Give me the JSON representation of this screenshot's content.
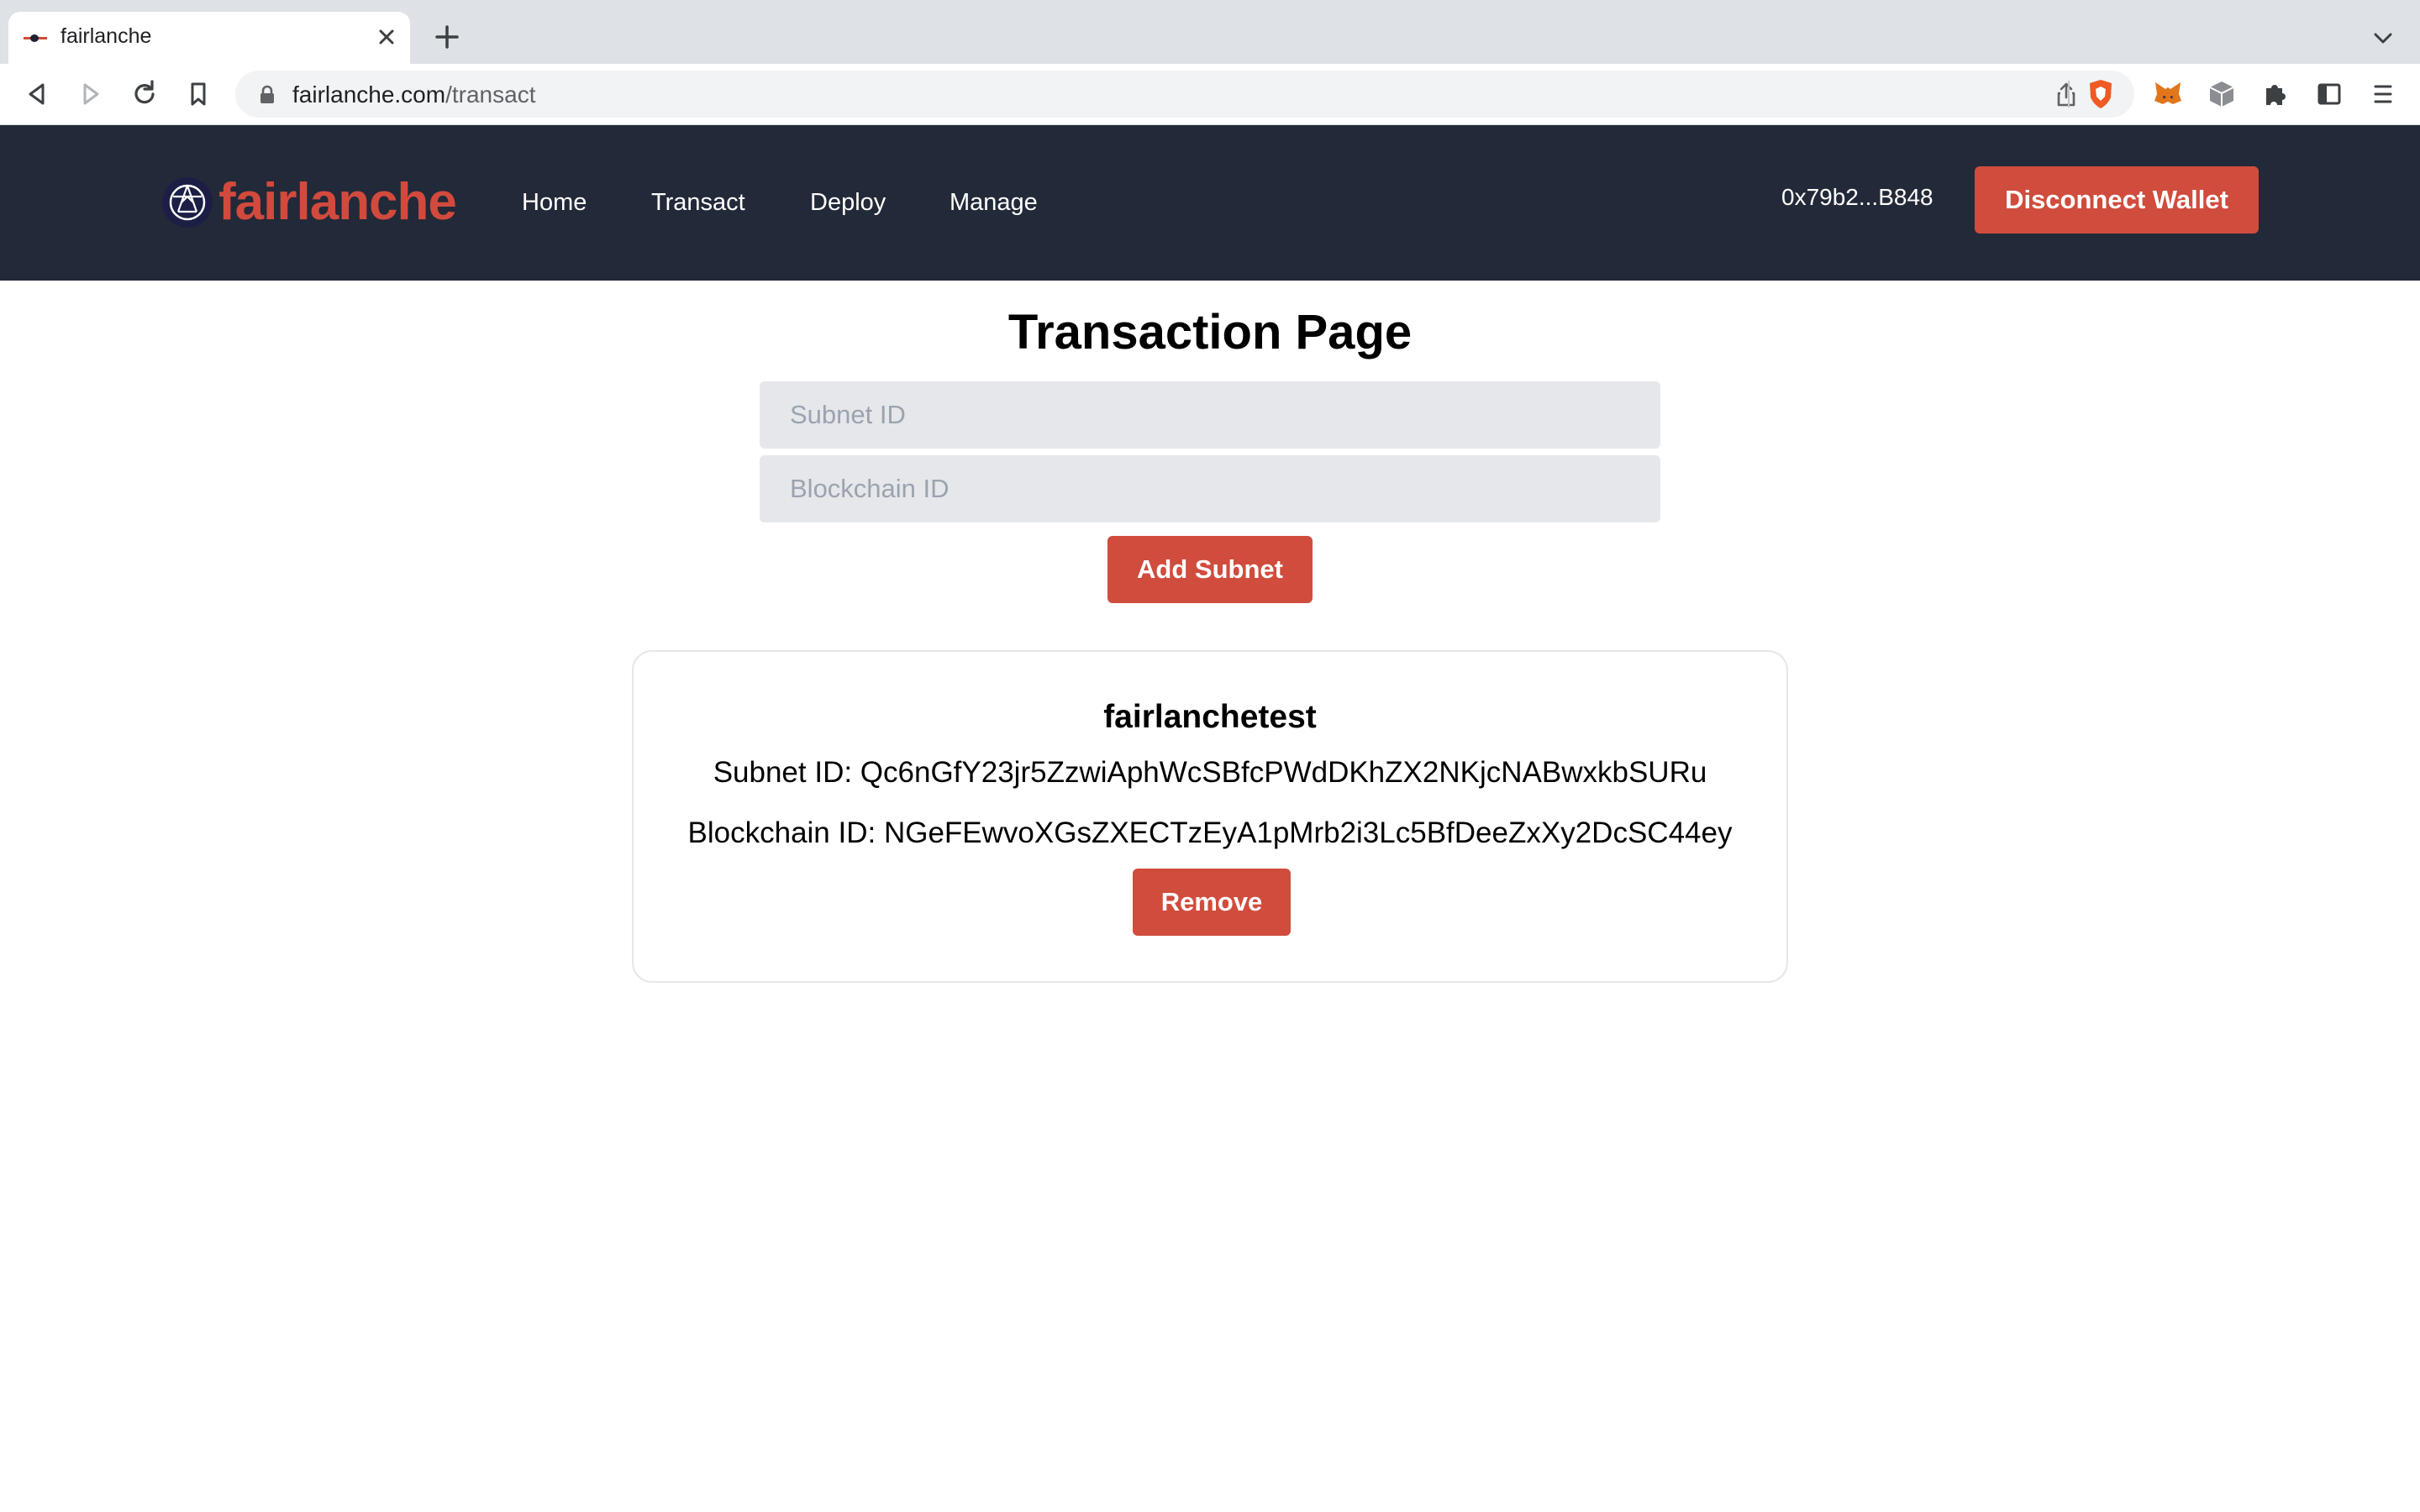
{
  "browser": {
    "tab_title": "fairlanche",
    "url_host": "fairlanche.com",
    "url_path": "/transact"
  },
  "header": {
    "logo_text": "fairlanche",
    "nav": [
      "Home",
      "Transact",
      "Deploy",
      "Manage"
    ],
    "wallet_address": "0x79b2...B848",
    "disconnect_label": "Disconnect Wallet"
  },
  "main": {
    "title": "Transaction Page",
    "subnet_placeholder": "Subnet ID",
    "blockchain_placeholder": "Blockchain ID",
    "add_subnet_label": "Add Subnet"
  },
  "subnets": [
    {
      "name": "fairlanchetest",
      "subnet_line": "Subnet ID: Qc6nGfY23jr5ZzwiAphWcSBfcPWdDKhZX2NKjcNABwxkbSURu",
      "blockchain_line": "Blockchain ID: NGeFEwvoXGsZXECTzEyA1pMrb2i3Lc5BfDeeZxXy2DcSC44ey",
      "remove_label": "Remove"
    }
  ],
  "colors": {
    "header_bg": "#222938",
    "brand_red": "#d04c3d",
    "input_bg": "#e5e7eb"
  },
  "icons": {
    "toolbar": [
      "back-icon",
      "forward-icon",
      "reload-icon",
      "bookmark-icon"
    ],
    "extensions": [
      "brave-shield-icon",
      "metamask-icon",
      "cube-extension-icon",
      "puzzle-extensions-icon",
      "sidebar-icon",
      "menu-icon"
    ]
  }
}
